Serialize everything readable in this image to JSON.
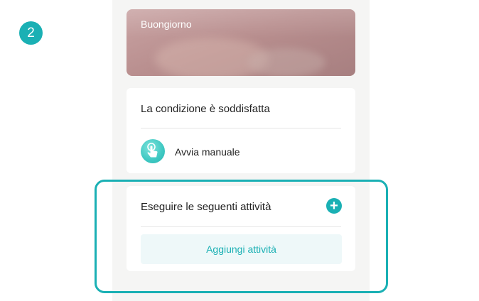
{
  "step": {
    "number": "2"
  },
  "banner": {
    "title": "Buongiorno"
  },
  "condition": {
    "title": "La condizione è soddisfatta",
    "manual": {
      "icon": "tap-hand-icon",
      "label": "Avvia manuale"
    }
  },
  "actions": {
    "title": "Eseguire le seguenti attività",
    "add_icon": "plus-icon",
    "add_button_label": "Aggiungi attività"
  },
  "colors": {
    "accent": "#1ab0b4",
    "button_bg": "#eef8f9",
    "screen_bg": "#f5f5f4"
  }
}
